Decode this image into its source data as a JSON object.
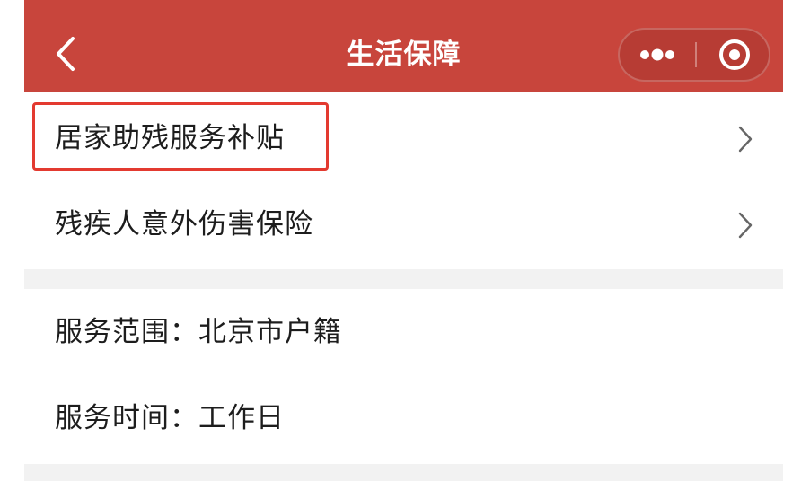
{
  "header": {
    "title": "生活保障",
    "background_color": "#c8453c",
    "back_icon": "chevron-left-icon",
    "more_icon": "more-dots-icon",
    "close_icon": "target-circle-icon"
  },
  "menu": {
    "items": [
      {
        "label": "居家助残服务补贴",
        "icon": "chevron-right-icon",
        "highlighted": true
      },
      {
        "label": "残疾人意外伤害保险",
        "icon": "chevron-right-icon",
        "highlighted": false
      }
    ]
  },
  "info": {
    "items": [
      {
        "label": "服务范围：北京市户籍"
      },
      {
        "label": "服务时间：工作日"
      }
    ]
  },
  "colors": {
    "highlight_border": "#e33a30",
    "text": "#1d1d1d",
    "separator": "#f2f2f2"
  }
}
